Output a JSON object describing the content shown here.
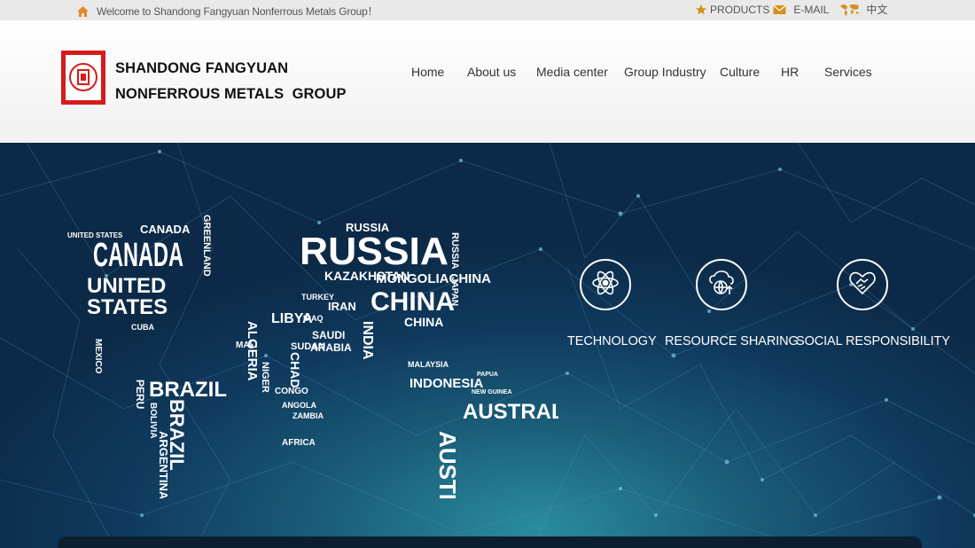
{
  "topbar": {
    "welcome": "Welcome to Shandong Fangyuan Nonferrous Metals Group！",
    "products": "PRODUCTS",
    "email": "E-MAIL",
    "language": "中文"
  },
  "brand": {
    "line1": "SHANDONG FANGYUAN",
    "line2": "NONFERROUS METALS  GROUP"
  },
  "nav": [
    "Home",
    "About us",
    "Media center",
    "Group Industry",
    "Culture",
    "HR",
    "Services"
  ],
  "map_words": {
    "canada": "CANADA",
    "canada_small": "CANADA",
    "united": "UNITED",
    "states": "STATES",
    "us_small": "UNITED STATES",
    "greenland": "GREENLAND",
    "russia": "RUSSIA",
    "russia_small": "RUSSIA",
    "kazakhstan": "KAZAKHSTAN",
    "mongolia_china": "MONGOLIACHINA",
    "china": "CHINA",
    "china_small": "CHINA",
    "japan": "JAPAN",
    "iran": "IRAN",
    "india": "INDIA",
    "algeria": "ALGERIA",
    "libya": "LIBYA",
    "saudi": "SAUDI",
    "arabia": "ARABIA",
    "sudan": "SUDAN",
    "chad": "CHAD",
    "mali": "MALI",
    "niger": "NIGER",
    "congo": "CONGO",
    "angola": "ANGOLA",
    "zambia": "ZAMBIA",
    "africa": "AFRICA",
    "brazil": "BRAZIL",
    "brazil2": "BRAZIL",
    "peru": "PERU",
    "argentina": "ARGENTINA",
    "bolivia": "BOLIVIA",
    "mexico": "MEXICO",
    "cuba": "CUBA",
    "malaysia": "MALAYSIA",
    "indonesia": "INDONESIA",
    "australia": "AUSTRALIA",
    "papua": "PAPUA",
    "new_guinea": "NEW GUINEA",
    "turkey": "TURKEY",
    "iraq": "IRAQ"
  },
  "features": [
    {
      "label": "TECHNOLOGY",
      "icon": "atom-icon"
    },
    {
      "label": "RESOURCE SHARING",
      "icon": "cloud-globe-icon"
    },
    {
      "label": "SOCIAL RESPONSIBILITY",
      "icon": "heart-hands-icon"
    }
  ],
  "colors": {
    "logo_red": "#d51c1c",
    "banner_dark": "#0c2a47",
    "banner_teal": "#2a8c9e",
    "star_orange": "#e8a020"
  }
}
